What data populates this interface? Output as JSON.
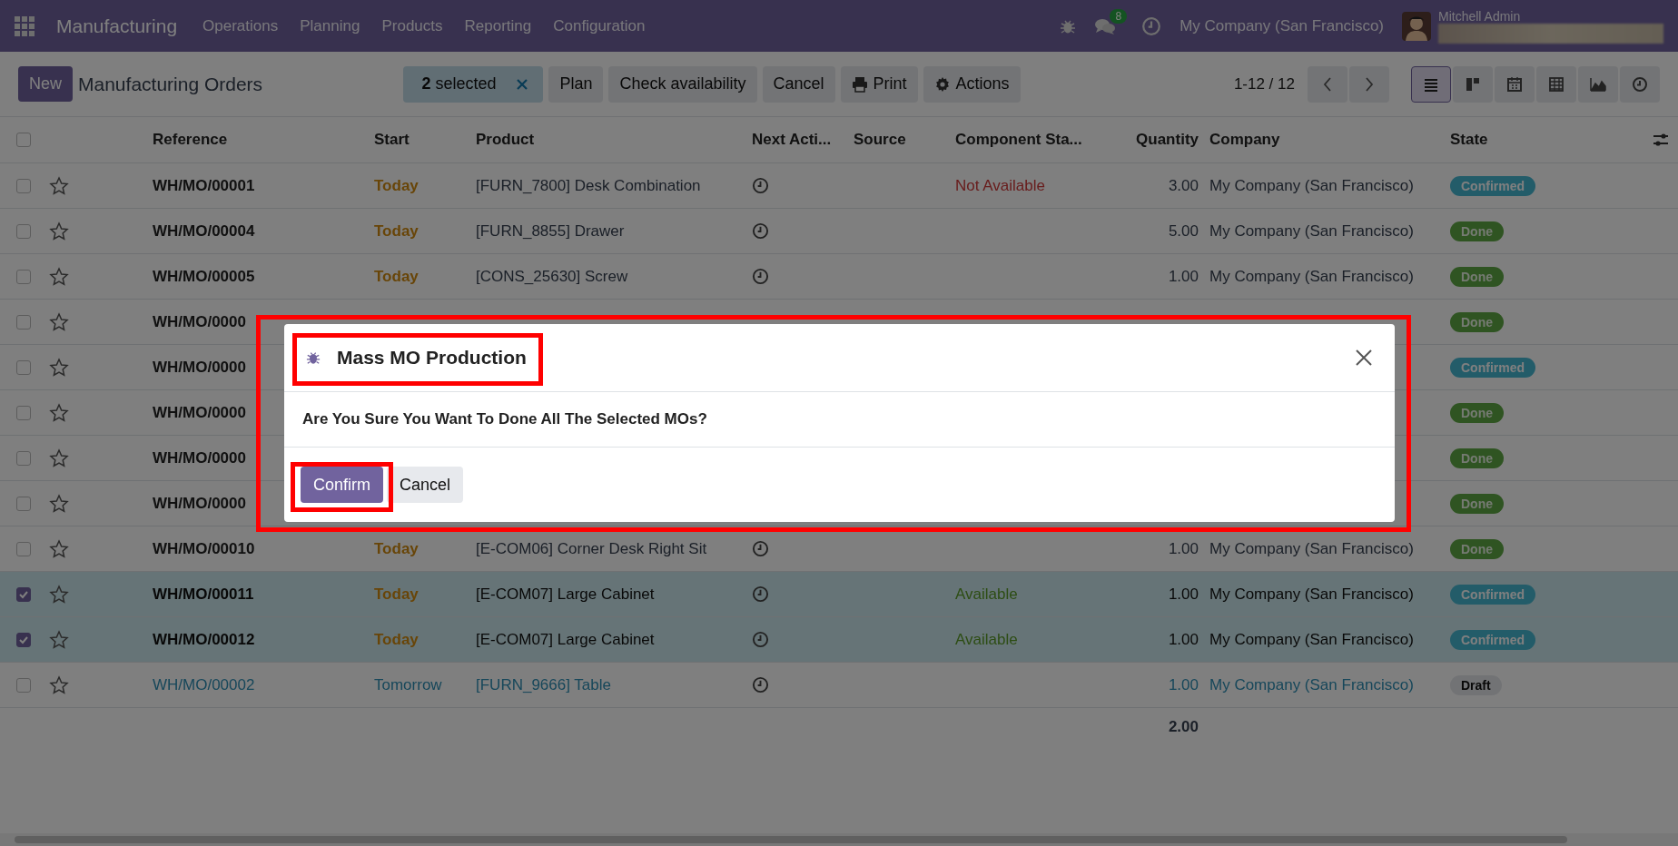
{
  "navbar": {
    "app_name": "Manufacturing",
    "menus": [
      "Operations",
      "Planning",
      "Products",
      "Reporting",
      "Configuration"
    ],
    "messages_count": "8",
    "company": "My Company (San Francisco)",
    "user": "Mitchell Admin"
  },
  "control_panel": {
    "new_button": "New",
    "breadcrumb": "Manufacturing Orders",
    "selection": "**2** selected",
    "actions": [
      {
        "label": "Plan"
      },
      {
        "label": "Check availability"
      },
      {
        "label": "Cancel"
      },
      {
        "label": "Print",
        "kind": "print"
      },
      {
        "label": "Actions",
        "kind": "gear"
      }
    ],
    "pager": "1-12 / 12",
    "views": [
      {
        "kind": "list",
        "selected": true
      },
      {
        "kind": "kanban",
        "selected": false
      },
      {
        "kind": "calendar",
        "selected": false
      },
      {
        "kind": "pivot",
        "selected": false
      },
      {
        "kind": "graph",
        "selected": false
      },
      {
        "kind": "activity",
        "selected": false
      }
    ]
  },
  "table": {
    "all_selected": false,
    "columns": [
      "Reference",
      "Start",
      "Product",
      "Next Acti...",
      "Source",
      "Component Sta...",
      "Quantity",
      "Company",
      "State"
    ],
    "rows": [
      {
        "selected": false,
        "reference": "WH/MO/00001",
        "start": "Today",
        "product": "[FURN_7800] Desk Combination",
        "activity": true,
        "component": {
          "text": "Not Available",
          "kind": "unavailable"
        },
        "quantity": "3.00",
        "company": "My Company (San Francisco)",
        "state": {
          "label": "Confirmed",
          "kind": "confirmed"
        }
      },
      {
        "selected": false,
        "reference": "WH/MO/00004",
        "start": "Today",
        "product": "[FURN_8855] Drawer",
        "activity": true,
        "quantity": "5.00",
        "company": "My Company (San Francisco)",
        "state": {
          "label": "Done",
          "kind": "done"
        }
      },
      {
        "selected": false,
        "reference": "WH/MO/00005",
        "start": "Today",
        "product": "[CONS_25630] Screw",
        "activity": true,
        "quantity": "1.00",
        "company": "My Company (San Francisco)",
        "state": {
          "label": "Done",
          "kind": "done"
        }
      },
      {
        "selected": false,
        "reference": "WH/MO/0000",
        "activity": false,
        "state": {
          "label": "Done",
          "kind": "done"
        }
      },
      {
        "selected": false,
        "reference": "WH/MO/0000",
        "activity": false,
        "state": {
          "label": "Confirmed",
          "kind": "confirmed"
        }
      },
      {
        "selected": false,
        "reference": "WH/MO/0000",
        "activity": false,
        "state": {
          "label": "Done",
          "kind": "done"
        }
      },
      {
        "selected": false,
        "reference": "WH/MO/0000",
        "activity": false,
        "state": {
          "label": "Done",
          "kind": "done"
        }
      },
      {
        "selected": false,
        "reference": "WH/MO/0000",
        "activity": false,
        "state": {
          "label": "Done",
          "kind": "done"
        }
      },
      {
        "selected": false,
        "reference": "WH/MO/00010",
        "start": "Today",
        "product": "[E-COM06] Corner Desk Right Sit",
        "activity": true,
        "quantity": "1.00",
        "company": "My Company (San Francisco)",
        "state": {
          "label": "Done",
          "kind": "done"
        }
      },
      {
        "selected": true,
        "reference": "WH/MO/00011",
        "start": "Today",
        "product": "[E-COM07] Large Cabinet",
        "activity": true,
        "component": {
          "text": "Available",
          "kind": "available"
        },
        "quantity": "1.00",
        "company": "My Company (San Francisco)",
        "state": {
          "label": "Confirmed",
          "kind": "confirmed"
        }
      },
      {
        "selected": true,
        "reference": "WH/MO/00012",
        "start": "Today",
        "product": "[E-COM07] Large Cabinet",
        "activity": true,
        "component": {
          "text": "Available",
          "kind": "available"
        },
        "quantity": "1.00",
        "company": "My Company (San Francisco)",
        "state": {
          "label": "Confirmed",
          "kind": "confirmed"
        }
      },
      {
        "selected": false,
        "reference": "WH/MO/00002",
        "start": "Tomorrow",
        "product": "[FURN_9666] Table",
        "activity": true,
        "quantity": "1.00",
        "company": "My Company (San Francisco)",
        "state": {
          "label": "Draft",
          "kind": "draft"
        }
      }
    ],
    "total_quantity": "2.00"
  },
  "dialog": {
    "title": "Mass MO Production",
    "message": "Are You Sure You Want To Done All The Selected MOs?",
    "buttons": [
      {
        "label": "Confirm",
        "primary": true
      },
      {
        "label": "Cancel",
        "primary": false
      }
    ]
  }
}
